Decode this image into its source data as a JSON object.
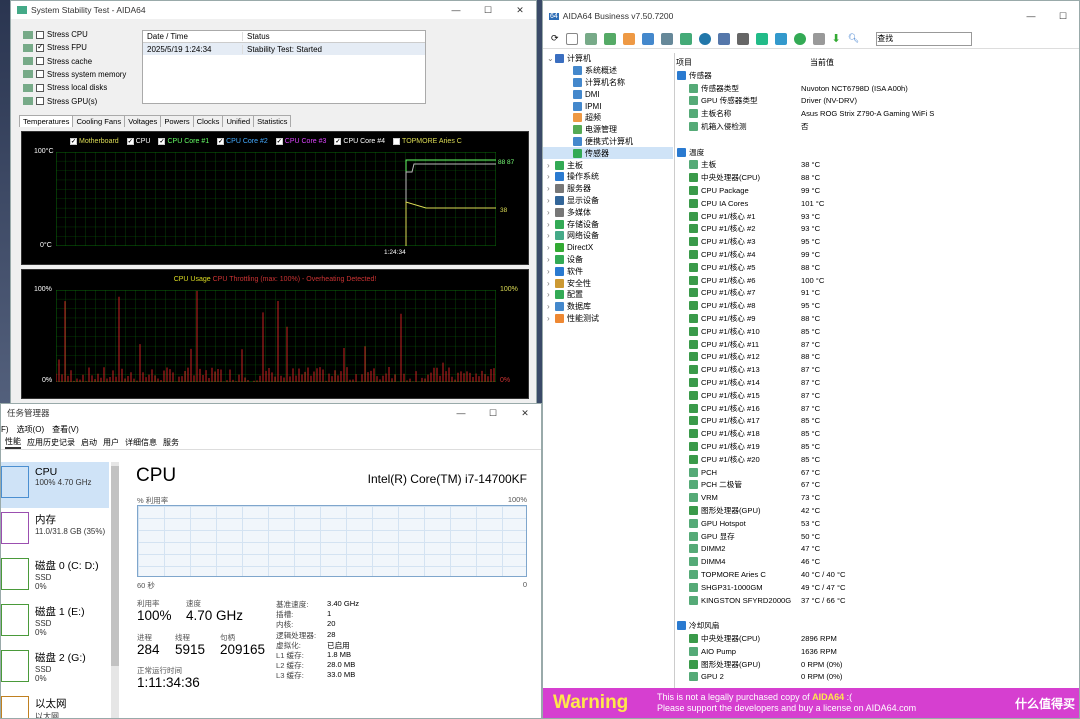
{
  "stability": {
    "title": "System Stability Test - AIDA64",
    "checks": [
      {
        "label": "Stress CPU",
        "on": false
      },
      {
        "label": "Stress FPU",
        "on": true
      },
      {
        "label": "Stress cache",
        "on": false
      },
      {
        "label": "Stress system memory",
        "on": false
      },
      {
        "label": "Stress local disks",
        "on": false
      },
      {
        "label": "Stress GPU(s)",
        "on": false
      }
    ],
    "list_headers": [
      "Date / Time",
      "Status"
    ],
    "list_row": [
      "2025/5/19 1:24:34",
      "Stability Test: Started"
    ],
    "tabs": [
      "Temperatures",
      "Cooling Fans",
      "Voltages",
      "Powers",
      "Clocks",
      "Unified",
      "Statistics"
    ],
    "legend": [
      "Motherboard",
      "CPU",
      "CPU Core #1",
      "CPU Core #2",
      "CPU Core #3",
      "CPU Core #4",
      "TOPMORE Aries C"
    ],
    "temp_top": "100°C",
    "temp_bottom": "0°C",
    "time_label": "1:24:34",
    "val_a": "88",
    "val_b": "87",
    "val_c": "38",
    "usage_title": "CPU Usage",
    "throttle_title": "CPU Throttling (max: 100%) - Overheating Detected!",
    "u_top": "100%",
    "u_bottom": "0%",
    "u_right_top": "100%",
    "u_right_bottom": "0%"
  },
  "taskmgr": {
    "title": "任务管理器",
    "menu": [
      "F)",
      "选项(O)",
      "查看(V)"
    ],
    "tabs": [
      "性能",
      "应用历史记录",
      "启动",
      "用户",
      "详细信息",
      "服务"
    ],
    "side": [
      {
        "t": "CPU",
        "s": "100% 4.70 GHz"
      },
      {
        "t": "内存",
        "s": "11.0/31.8 GB (35%)"
      },
      {
        "t": "磁盘 0 (C: D:)",
        "s": "SSD",
        "p": "0%"
      },
      {
        "t": "磁盘 1 (E:)",
        "s": "SSD",
        "p": "0%"
      },
      {
        "t": "磁盘 2 (G:)",
        "s": "SSD",
        "p": "0%"
      },
      {
        "t": "以太网",
        "s": "以太网"
      }
    ],
    "heading": "CPU",
    "cpu_name": "Intel(R) Core(TM) i7-14700KF",
    "graph_label": "% 利用率",
    "graph_max": "100%",
    "graph_time": "60 秒",
    "graph_min": "0",
    "util_l": "利用率",
    "util_v": "100%",
    "speed_l": "速度",
    "speed_v": "4.70 GHz",
    "proc_l": "进程",
    "proc_v": "284",
    "thr_l": "线程",
    "thr_v": "5915",
    "hnd_l": "句柄",
    "hnd_v": "209165",
    "up_l": "正常运行时间",
    "up_v": "1:11:34:36",
    "kv": [
      [
        "基准速度:",
        "3.40 GHz"
      ],
      [
        "插槽:",
        "1"
      ],
      [
        "内核:",
        "20"
      ],
      [
        "逻辑处理器:",
        "28"
      ],
      [
        "虚拟化:",
        "已启用"
      ],
      [
        "L1 缓存:",
        "1.8 MB"
      ],
      [
        "L2 缓存:",
        "28.0 MB"
      ],
      [
        "L3 缓存:",
        "33.0 MB"
      ]
    ]
  },
  "aida": {
    "title": "AIDA64 Business v7.50.7200",
    "search": "查找",
    "icon_label": "64",
    "tree": [
      "计算机",
      "系统概述",
      "计算机名称",
      "DMI",
      "IPMI",
      "超频",
      "电源管理",
      "便携式计算机",
      "传感器",
      "主板",
      "操作系统",
      "服务器",
      "显示设备",
      "多媒体",
      "存储设备",
      "网络设备",
      "DirectX",
      "设备",
      "软件",
      "安全性",
      "配置",
      "数据库",
      "性能测试"
    ],
    "col1": "项目",
    "col2": "当前值",
    "rows": [
      {
        "k": "传感器",
        "v": "",
        "sec": true
      },
      {
        "k": "传感器类型",
        "v": "Nuvoton NCT6798D  (ISA A00h)"
      },
      {
        "k": "GPU 传感器类型",
        "v": "Driver  (NV-DRV)"
      },
      {
        "k": "主板名称",
        "v": "Asus ROG Strix Z790-A Gaming WiFi S"
      },
      {
        "k": "机箱入侵检测",
        "v": "否"
      },
      {
        "k": "",
        "v": ""
      },
      {
        "k": "温度",
        "v": "",
        "sec": true
      },
      {
        "k": "主板",
        "v": "38 °C"
      },
      {
        "k": "中央处理器(CPU)",
        "v": "88 °C"
      },
      {
        "k": "CPU Package",
        "v": "99 °C"
      },
      {
        "k": "CPU IA Cores",
        "v": "101 °C"
      },
      {
        "k": "CPU #1/核心 #1",
        "v": "93 °C"
      },
      {
        "k": "CPU #1/核心 #2",
        "v": "93 °C"
      },
      {
        "k": "CPU #1/核心 #3",
        "v": "95 °C"
      },
      {
        "k": "CPU #1/核心 #4",
        "v": "99 °C"
      },
      {
        "k": "CPU #1/核心 #5",
        "v": "88 °C"
      },
      {
        "k": "CPU #1/核心 #6",
        "v": "100 °C"
      },
      {
        "k": "CPU #1/核心 #7",
        "v": "91 °C"
      },
      {
        "k": "CPU #1/核心 #8",
        "v": "95 °C"
      },
      {
        "k": "CPU #1/核心 #9",
        "v": "88 °C"
      },
      {
        "k": "CPU #1/核心 #10",
        "v": "85 °C"
      },
      {
        "k": "CPU #1/核心 #11",
        "v": "87 °C"
      },
      {
        "k": "CPU #1/核心 #12",
        "v": "88 °C"
      },
      {
        "k": "CPU #1/核心 #13",
        "v": "87 °C"
      },
      {
        "k": "CPU #1/核心 #14",
        "v": "87 °C"
      },
      {
        "k": "CPU #1/核心 #15",
        "v": "87 °C"
      },
      {
        "k": "CPU #1/核心 #16",
        "v": "87 °C"
      },
      {
        "k": "CPU #1/核心 #17",
        "v": "85 °C"
      },
      {
        "k": "CPU #1/核心 #18",
        "v": "85 °C"
      },
      {
        "k": "CPU #1/核心 #19",
        "v": "85 °C"
      },
      {
        "k": "CPU #1/核心 #20",
        "v": "85 °C"
      },
      {
        "k": "PCH",
        "v": "67 °C"
      },
      {
        "k": "PCH 二极管",
        "v": "67 °C"
      },
      {
        "k": "VRM",
        "v": "73 °C"
      },
      {
        "k": "图形处理器(GPU)",
        "v": "42 °C"
      },
      {
        "k": "GPU Hotspot",
        "v": "53 °C"
      },
      {
        "k": "GPU 显存",
        "v": "50 °C"
      },
      {
        "k": "DIMM2",
        "v": "47 °C"
      },
      {
        "k": "DIMM4",
        "v": "46 °C"
      },
      {
        "k": "TOPMORE Aries C",
        "v": "40 °C / 40 °C"
      },
      {
        "k": "SHGP31-1000GM",
        "v": "49 °C / 47 °C"
      },
      {
        "k": "KINGSTON SFYRD2000G",
        "v": "37 °C / 66 °C"
      },
      {
        "k": "",
        "v": ""
      },
      {
        "k": "冷却风扇",
        "v": "",
        "sec": true
      },
      {
        "k": "中央处理器(CPU)",
        "v": "2896 RPM"
      },
      {
        "k": "AIO Pump",
        "v": "1636 RPM"
      },
      {
        "k": "图形处理器(GPU)",
        "v": "0 RPM  (0%)"
      },
      {
        "k": "GPU 2",
        "v": "0 RPM  (0%)"
      }
    ],
    "warn_big": "Warning",
    "warn_l1a": "This is not a legally purchased copy of ",
    "warn_l1b": "AIDA64",
    "warn_l1c": " :(",
    "warn_l2": "Please support the developers and buy a license on AIDA64.com",
    "site": "什么值得买"
  }
}
